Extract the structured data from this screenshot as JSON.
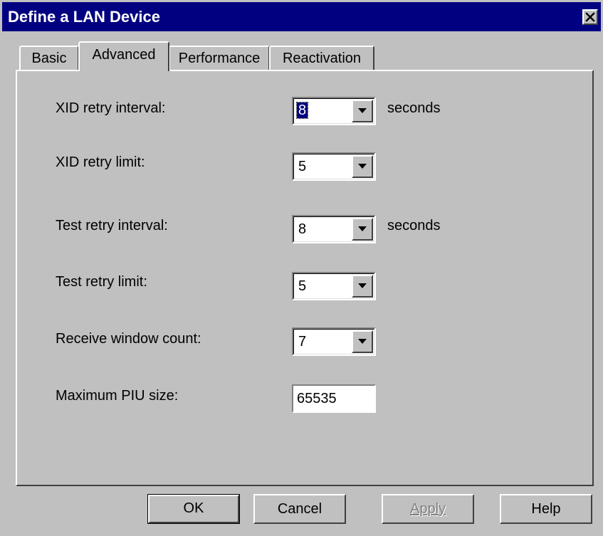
{
  "window": {
    "title": "Define a LAN Device"
  },
  "tabs": [
    {
      "label": "Basic",
      "active": false
    },
    {
      "label": "Advanced",
      "active": true
    },
    {
      "label": "Performance",
      "active": false
    },
    {
      "label": "Reactivation",
      "active": false
    }
  ],
  "fields": [
    {
      "label": "XID retry interval:",
      "value": "8",
      "unit": "seconds",
      "control": "combo"
    },
    {
      "label": "XID retry limit:",
      "value": "5",
      "unit": "",
      "control": "combo"
    },
    {
      "label": "Test retry interval:",
      "value": "8",
      "unit": "seconds",
      "control": "combo"
    },
    {
      "label": "Test retry limit:",
      "value": "5",
      "unit": "",
      "control": "combo"
    },
    {
      "label": "Receive window count:",
      "value": "7",
      "unit": "",
      "control": "combo"
    },
    {
      "label": "Maximum PIU size:",
      "value": "65535",
      "unit": "",
      "control": "text"
    }
  ],
  "buttons": {
    "ok": "OK",
    "cancel": "Cancel",
    "apply": "Apply",
    "help": "Help"
  },
  "icons": {
    "close": "close-icon",
    "dropdown": "chevron-down-icon"
  },
  "colors": {
    "titlebar": "#000080",
    "face": "#c0c0c0",
    "selection": "#000080"
  }
}
